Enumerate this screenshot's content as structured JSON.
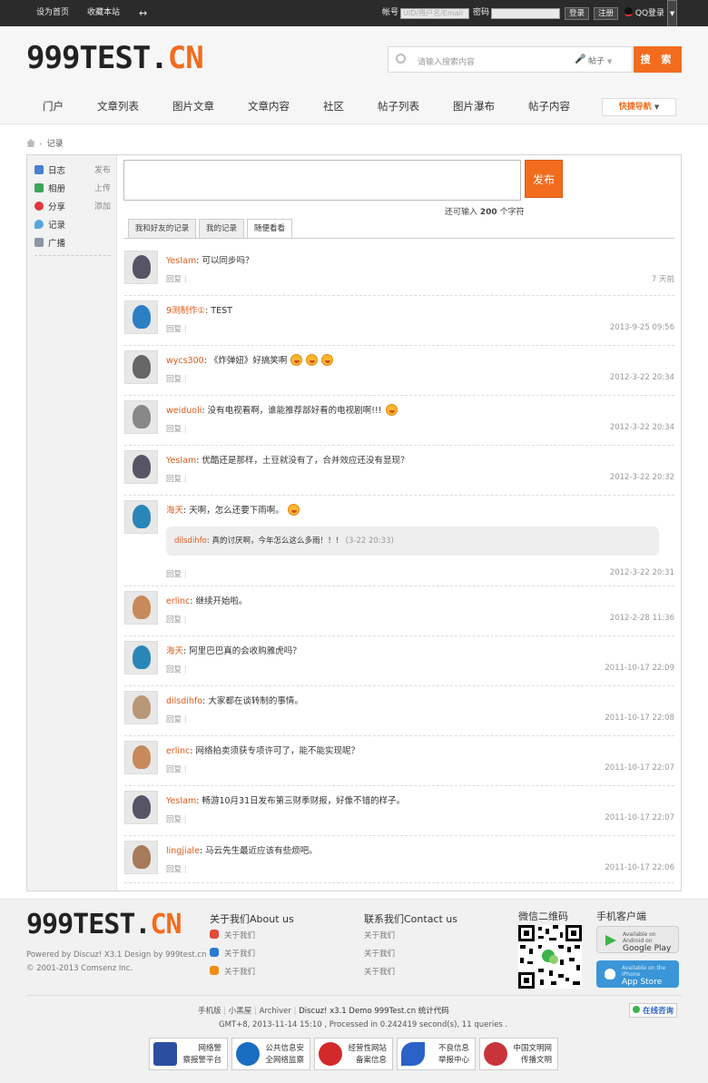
{
  "topbar": {
    "set_home": "设为首页",
    "bookmark": "收藏本站",
    "toggle": "↔",
    "account_label": "帐号",
    "account_placeholder": "UID/用户名/Email",
    "password_label": "密码",
    "login": "登录",
    "register": "注册",
    "qq_login": "QQ登录"
  },
  "brand": {
    "logo_main": "999TEST.",
    "logo_cn": "CN"
  },
  "search": {
    "placeholder": "请输入搜索内容",
    "type": "帖子",
    "button": "搜 索"
  },
  "nav": [
    "门户",
    "文章列表",
    "图片文章",
    "文章内容",
    "社区",
    "帖子列表",
    "图片瀑布",
    "帖子内容"
  ],
  "quick_nav": "快捷导航",
  "breadcrumb": {
    "current": "记录"
  },
  "sidebar": [
    {
      "label": "日志",
      "action": "发布",
      "color": "#4a7fd0"
    },
    {
      "label": "相册",
      "action": "上传",
      "color": "#3aa657"
    },
    {
      "label": "分享",
      "action": "添加",
      "color": "#e0383e"
    },
    {
      "label": "记录",
      "action": "",
      "color": "#58a6dc"
    },
    {
      "label": "广播",
      "action": "",
      "color": "#8b96a6"
    }
  ],
  "composer": {
    "publish": "发布",
    "remaining_prefix": "还可输入",
    "remaining_count": "200",
    "remaining_suffix": "个字符"
  },
  "tabs": [
    "我和好友的记录",
    "我的记录",
    "随便看看"
  ],
  "feed": [
    {
      "user": "YesIam",
      "text": ": 可以同步吗？",
      "emojis": 0,
      "time": "7 天前",
      "avatar": "#556"
    },
    {
      "user": "9测制作①",
      "text": ": TEST",
      "emojis": 0,
      "time": "2013-9-25 09:56",
      "avatar": "#2d7fc4"
    },
    {
      "user": "wycs300",
      "text": ": 《炸弹妞》好搞笑啊",
      "emojis": 3,
      "time": "2012-3-22 20:34",
      "avatar": "#666"
    },
    {
      "user": "weiduoli",
      "text": ": 没有电视看啊，谁能推荐部好看的电视剧啊!!!",
      "emojis": 1,
      "time": "2012-3-22 20:34",
      "avatar": "#888"
    },
    {
      "user": "YesIam",
      "text": ": 优酷还是那样，土豆就没有了，合并效应还没有显现？",
      "emojis": 0,
      "time": "2012-3-22 20:32",
      "avatar": "#556"
    },
    {
      "user": "海天",
      "text": ": 天啊，怎么还要下雨啊。",
      "emojis": 1,
      "time": "2012-3-22 20:31",
      "avatar": "#2a86b8",
      "reply": {
        "user": "dilsdihfo",
        "text": ": 真的讨厌啊，今年怎么这么多雨！！！",
        "time": "(3-22 20:33)"
      }
    },
    {
      "user": "erlinc",
      "text": ": 继续开始啦。",
      "emojis": 0,
      "time": "2012-2-28 11:36",
      "avatar": "#c88a5a"
    },
    {
      "user": "海天",
      "text": ": 阿里巴巴真的会收购雅虎吗？",
      "emojis": 0,
      "time": "2011-10-17 22:09",
      "avatar": "#2a86b8"
    },
    {
      "user": "dilsdihfo",
      "text": ": 大家都在谈转制的事情。",
      "emojis": 0,
      "time": "2011-10-17 22:08",
      "avatar": "#b89878"
    },
    {
      "user": "erlinc",
      "text": ": 网络拍卖须获专项许可了，能不能实现呢？",
      "emojis": 0,
      "time": "2011-10-17 22:07",
      "avatar": "#c88a5a"
    },
    {
      "user": "YesIam",
      "text": ": 畅游10月31日发布第三财季财报，好像不错的样子。",
      "emojis": 0,
      "time": "2011-10-17 22:07",
      "avatar": "#556"
    },
    {
      "user": "lingjiale",
      "text": ": 马云先生最近应该有些烦吧。",
      "emojis": 0,
      "time": "2011-10-17 22:06",
      "avatar": "#a67a5a"
    }
  ],
  "reply_label": "回复",
  "reply_sep": "|",
  "footer": {
    "powered": "Powered by Discuz! X3.1 Design by 999test.cn",
    "copyright": "© 2001-2013 Comsenz Inc.",
    "about_title": "关于我们About us",
    "about_links": [
      "关于我们",
      "关于我们",
      "关于我们"
    ],
    "contact_title": "联系我们Contact us",
    "contact_links": [
      "关于我们",
      "关于我们",
      "关于我们"
    ],
    "wechat_title": "微信二维码",
    "mobile_title": "手机客户端",
    "google_small": "Available on Android on",
    "google_big": "Google Play",
    "apple_small": "Available on the iPhone",
    "apple_big": "App Store",
    "links": [
      "手机版",
      "小黑屋",
      "Archiver",
      "Discuz! x3.1 Demo 999Test.cn 统计代码"
    ],
    "online_consult": "在线咨询",
    "stats": "GMT+8, 2013-11-14 15:10 , Processed in 0.242419 second(s), 11 queries .",
    "badges": [
      {
        "l1": "网络警",
        "l2": "察报警平台",
        "color": "#2b4ea0"
      },
      {
        "l1": "公共信息安",
        "l2": "全网络监察",
        "color": "#1a6ec2"
      },
      {
        "l1": "经营性网站",
        "l2": "备案信息",
        "color": "#d22a2a"
      },
      {
        "l1": "不良信息",
        "l2": "举报中心",
        "color": "#2a62c8"
      },
      {
        "l1": "中国文明网",
        "l2": "传播文明",
        "color": "#c8343a"
      }
    ]
  }
}
